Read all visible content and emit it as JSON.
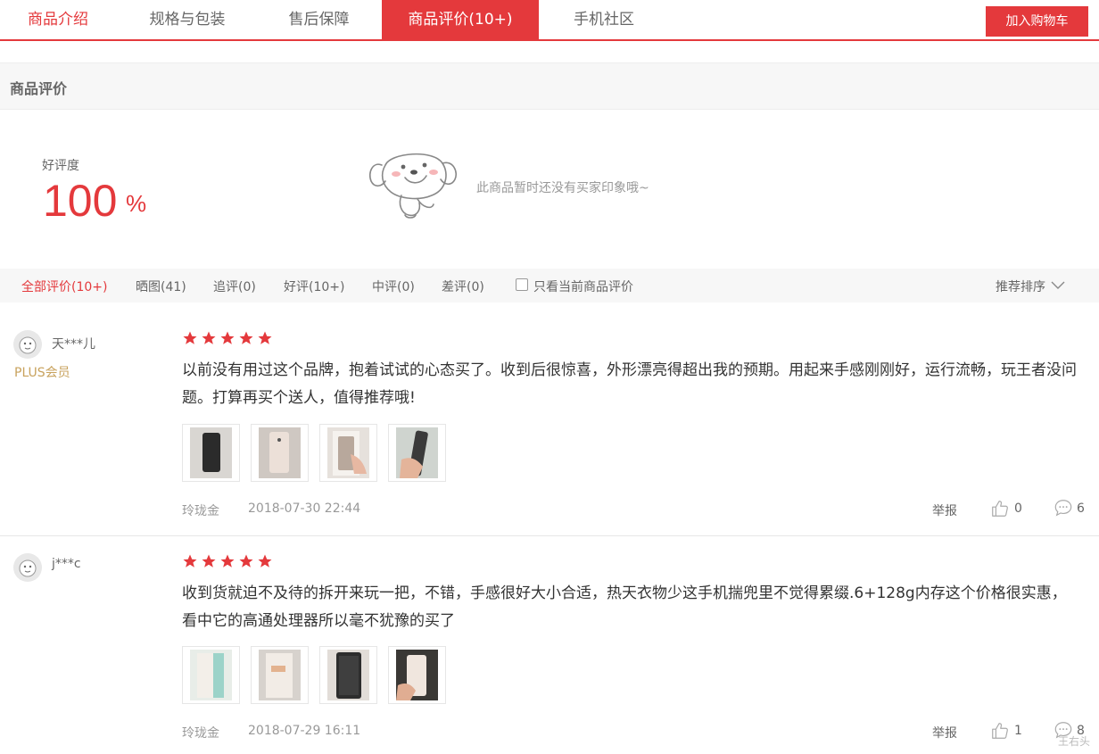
{
  "tabs": {
    "items": [
      {
        "label": "商品介绍"
      },
      {
        "label": "规格与包装"
      },
      {
        "label": "售后保障"
      },
      {
        "label": "商品评价(10+)"
      },
      {
        "label": "手机社区"
      }
    ],
    "active_index": 3,
    "cart_button": "加入购物车"
  },
  "section": {
    "title": "商品评价"
  },
  "summary": {
    "label": "好评度",
    "value": "100",
    "unit": "%",
    "empty_text": "此商品暂时还没有买家印象哦~"
  },
  "filters": {
    "items": [
      {
        "label": "全部评价(10+)"
      },
      {
        "label": "晒图(41)"
      },
      {
        "label": "追评(0)"
      },
      {
        "label": "好评(10+)"
      },
      {
        "label": "中评(0)"
      },
      {
        "label": "差评(0)"
      }
    ],
    "checkbox_label": "只看当前商品评价",
    "sort_label": "推荐排序"
  },
  "reviews": [
    {
      "user": "天***儿",
      "badge": "PLUS会员",
      "stars": 5,
      "content": "以前没有用过这个品牌，抱着试试的心态买了。收到后很惊喜，外形漂亮得超出我的预期。用起来手感刚刚好，运行流畅，玩王者没问题。打算再买个送人，值得推荐哦!",
      "variant": "玲珑金",
      "date": "2018-07-30 22:44",
      "report": "举报",
      "likes": "0",
      "comments": "6"
    },
    {
      "user": "j***c",
      "stars": 5,
      "content": "收到货就迫不及待的拆开来玩一把，不错，手感很好大小合适，热天衣物少这手机揣兜里不觉得累缀.6+128g内存这个价格很实惠，看中它的高通处理器所以毫不犹豫的买了",
      "variant": "玲珑金",
      "date": "2018-07-29 16:11",
      "report": "举报",
      "likes": "1",
      "comments": "8"
    }
  ],
  "watermark": "王右头",
  "colors": {
    "accent": "#e4393c",
    "plus": "#c8a25d",
    "muted": "#999999"
  }
}
